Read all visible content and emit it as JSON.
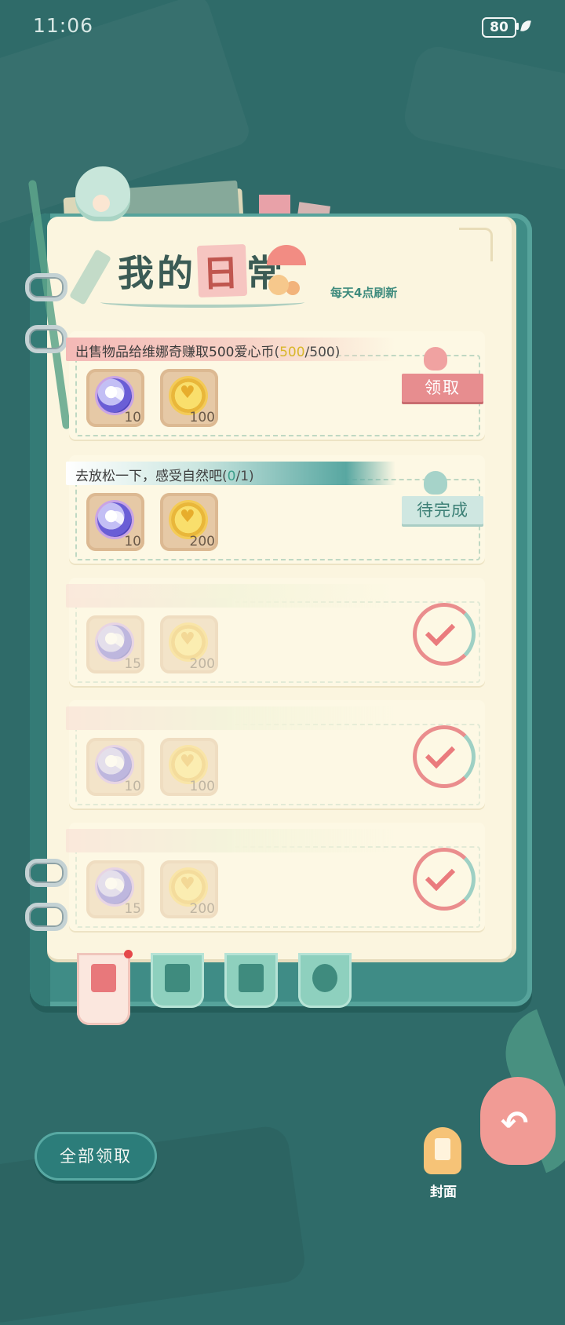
{
  "status_bar": {
    "time": "11:06",
    "battery": "80"
  },
  "header": {
    "title_part1": "我的",
    "title_part2": "日",
    "title_part3": "常",
    "refresh_note": "每天4点刷新"
  },
  "tasks": [
    {
      "title": "出售物品给维娜奇赚取500爱心币",
      "progress_current": "500",
      "progress_total": "500",
      "status": "claimable",
      "button_label": "领取",
      "rewards": [
        {
          "icon": "gem-icon",
          "qty": "10"
        },
        {
          "icon": "coin-icon",
          "qty": "100"
        }
      ]
    },
    {
      "title": "去放松一下，感受自然吧",
      "progress_current": "0",
      "progress_total": "1",
      "status": "pending",
      "button_label": "待完成",
      "rewards": [
        {
          "icon": "gem-icon",
          "qty": "10"
        },
        {
          "icon": "coin-icon",
          "qty": "200"
        }
      ]
    },
    {
      "status": "completed",
      "rewards": [
        {
          "icon": "gem-icon",
          "qty": "15"
        },
        {
          "icon": "coin-icon",
          "qty": "200"
        }
      ]
    },
    {
      "status": "completed",
      "rewards": [
        {
          "icon": "gem-icon",
          "qty": "10"
        },
        {
          "icon": "coin-icon",
          "qty": "100"
        }
      ]
    },
    {
      "status": "completed",
      "rewards": [
        {
          "icon": "gem-icon",
          "qty": "15"
        },
        {
          "icon": "coin-icon",
          "qty": "200"
        }
      ]
    }
  ],
  "tabs": [
    {
      "icon": "daily-notes-icon",
      "active": true
    },
    {
      "icon": "photo-album-icon",
      "active": false
    },
    {
      "icon": "book-star-icon",
      "active": false
    },
    {
      "icon": "flower-icon",
      "active": false
    }
  ],
  "bottom": {
    "claim_all_label": "全部领取",
    "cover_label": "封面"
  },
  "colors": {
    "background": "#2f6b69",
    "page": "#fbf5df",
    "claim_button": "#e78d8f",
    "pending_button": "#cfe7e1",
    "claim_all_button": "#2c7d7a"
  }
}
